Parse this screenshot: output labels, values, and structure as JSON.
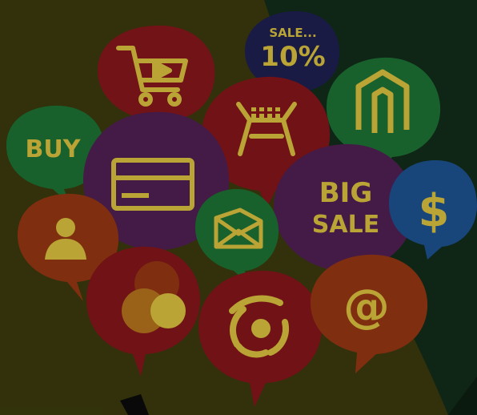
{
  "image": {
    "bubbles": [
      {
        "label": "BUY"
      },
      {
        "label_line1": "SALE...",
        "label_line2": "10%"
      },
      {
        "label_line1": "BIG",
        "label_line2": "SALE"
      },
      {
        "label": "$"
      },
      {
        "label": "@"
      }
    ],
    "icons": [
      "cart-icon",
      "discount-10-icon",
      "magento-icon",
      "buy-icon",
      "credit-card-icon",
      "shop-basket-icon",
      "big-sale-icon",
      "dollar-icon",
      "user-icon",
      "mail-icon",
      "circles-icon",
      "rss-icon",
      "at-icon"
    ],
    "colors": {
      "bg_yellow": "#4a4a14",
      "bg_green": "#1d3a23",
      "red": "#7a1418",
      "purple": "#4b1f4d",
      "green": "#1c6b31",
      "navy": "#1d1f4a",
      "blue": "#1b4c86",
      "orange": "#8a3312",
      "glyph": "#c9b23a"
    }
  }
}
